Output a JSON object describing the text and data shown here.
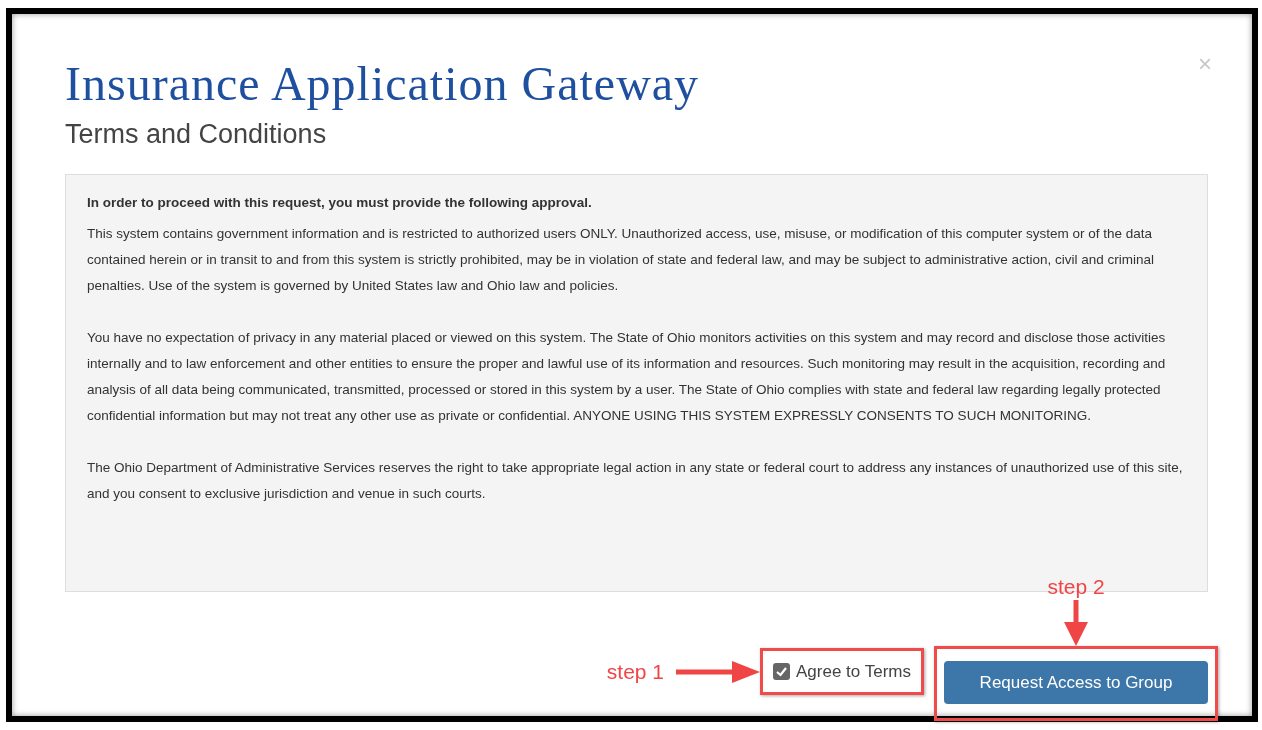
{
  "dialog": {
    "close": "×",
    "title": "Insurance Application Gateway",
    "subtitle": "Terms and Conditions"
  },
  "terms": {
    "heading": "In order to proceed with this request, you must provide the following approval.",
    "paragraphs": [
      "This system contains government information and is restricted to authorized users ONLY. Unauthorized access, use, misuse, or modification of this computer system or of the data contained herein or in transit to and from this system is strictly prohibited, may be in violation of state and federal law, and may be subject to administrative action, civil and criminal penalties. Use of the system is governed by United States law and Ohio law and policies.",
      "You have no expectation of privacy in any material placed or viewed on this system. The State of Ohio monitors activities on this system and may record and disclose those activities internally and to law enforcement and other entities to ensure the proper and lawful use of its information and resources. Such monitoring may result in the acquisition, recording and analysis of all data being communicated, transmitted, processed or stored in this system by a user. The State of Ohio complies with state and federal law regarding legally protected confidential information but may not treat any other use as private or confidential. ANYONE USING THIS SYSTEM EXPRESSLY CONSENTS TO SUCH MONITORING.",
      "The Ohio Department of Administrative Services reserves the right to take appropriate legal action in any state or federal court to address any instances of unauthorized use of this site, and you consent to exclusive jurisdiction and venue in such courts."
    ]
  },
  "agree": {
    "label": "Agree to Terms",
    "checked": true
  },
  "submit_button": "Request Access to Group",
  "annotations": [
    "step 1",
    "step 2"
  ]
}
